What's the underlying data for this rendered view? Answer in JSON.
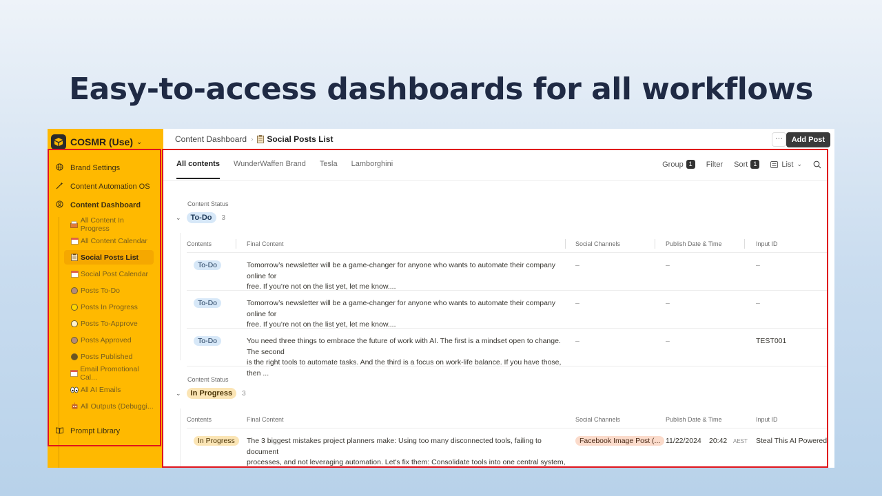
{
  "headline": "Easy-to-access dashboards for all workflows",
  "colors": {
    "sidebar_bg": "#ffb900",
    "highlight_border": "#e0141c",
    "headline": "#1f2a44"
  },
  "sidebar": {
    "workspace": "COSMR (Use)",
    "items": [
      {
        "label": "Brand Settings",
        "icon": "globe-icon"
      },
      {
        "label": "Content Automation OS",
        "icon": "magic-wand-icon"
      },
      {
        "label": "Content Dashboard",
        "icon": "user-circle-icon"
      }
    ],
    "subitems": [
      {
        "label": "All Content In Progress",
        "icon": "inbox-tray-icon"
      },
      {
        "label": "All Content Calendar",
        "icon": "calendar-icon"
      },
      {
        "label": "Social Posts List",
        "icon": "clipboard-icon"
      },
      {
        "label": "Social Post Calendar",
        "icon": "calendar-icon"
      },
      {
        "label": "Posts To-Do",
        "icon": "circle-brown-icon"
      },
      {
        "label": "Posts In Progress",
        "icon": "circle-yellow-icon"
      },
      {
        "label": "Posts To-Approve",
        "icon": "circle-white-icon"
      },
      {
        "label": "Posts Approved",
        "icon": "circle-brown-icon"
      },
      {
        "label": "Posts Published",
        "icon": "circle-dark-icon"
      },
      {
        "label": "Email Promotional Cal...",
        "icon": "calendar-icon"
      },
      {
        "label": "All AI Emails",
        "icon": "eyes-icon"
      },
      {
        "label": "All Outputs (Debuggi...",
        "icon": "robot-icon"
      }
    ],
    "footer": {
      "label": "Prompt Library",
      "icon": "book-icon"
    }
  },
  "topbar": {
    "crumb_parent": "Content Dashboard",
    "crumb_current": "Social Posts List",
    "more": "···",
    "add_post": "Add Post"
  },
  "tabs": [
    "All contents",
    "WunderWaffen Brand",
    "Tesla",
    "Lamborghini"
  ],
  "toolbar": {
    "group": "Group",
    "group_count": "1",
    "filter": "Filter",
    "sort": "Sort",
    "sort_count": "1",
    "view": "List"
  },
  "columns": [
    "Contents",
    "Final Content",
    "Social Channels",
    "Publish Date & Time",
    "Input ID"
  ],
  "groups": [
    {
      "label": "Content Status",
      "name": "To-Do",
      "count": "3",
      "rows": [
        {
          "status": "To-Do",
          "content": [
            "Tomorrow’s newsletter will be a game-changer for anyone who wants to automate their company online for",
            "free. If you’re not on the list yet, let me know...."
          ],
          "channels": "–",
          "date": "–",
          "input_id": "–"
        },
        {
          "status": "To-Do",
          "content": [
            "Tomorrow’s newsletter will be a game-changer for anyone who wants to automate their company online for",
            "free. If you’re not on the list yet, let me know...."
          ],
          "channels": "–",
          "date": "–",
          "input_id": "–"
        },
        {
          "status": "To-Do",
          "content": [
            "You need three things to embrace the future of work with AI. The first is a mindset open to change. The second",
            "is the right tools to automate tasks. And the third is a focus on work-life balance. If you have those, then ..."
          ],
          "channels": "–",
          "date": "–",
          "input_id": "TEST001"
        }
      ]
    },
    {
      "label": "Content Status",
      "name": "In Progress",
      "count": "3",
      "rows": [
        {
          "status": "In Progress",
          "content": [
            "The 3 biggest mistakes project planners make: Using too many disconnected tools, failing to document",
            "processes, and not leveraging automation. Let's fix them: Consolidate tools into one central system, create a ..."
          ],
          "channels": "Facebook Image Post (...",
          "date": "11/22/2024",
          "time": "20:42",
          "tz": "AEST",
          "input_id": "Steal This AI Powered Proj..."
        }
      ]
    }
  ]
}
